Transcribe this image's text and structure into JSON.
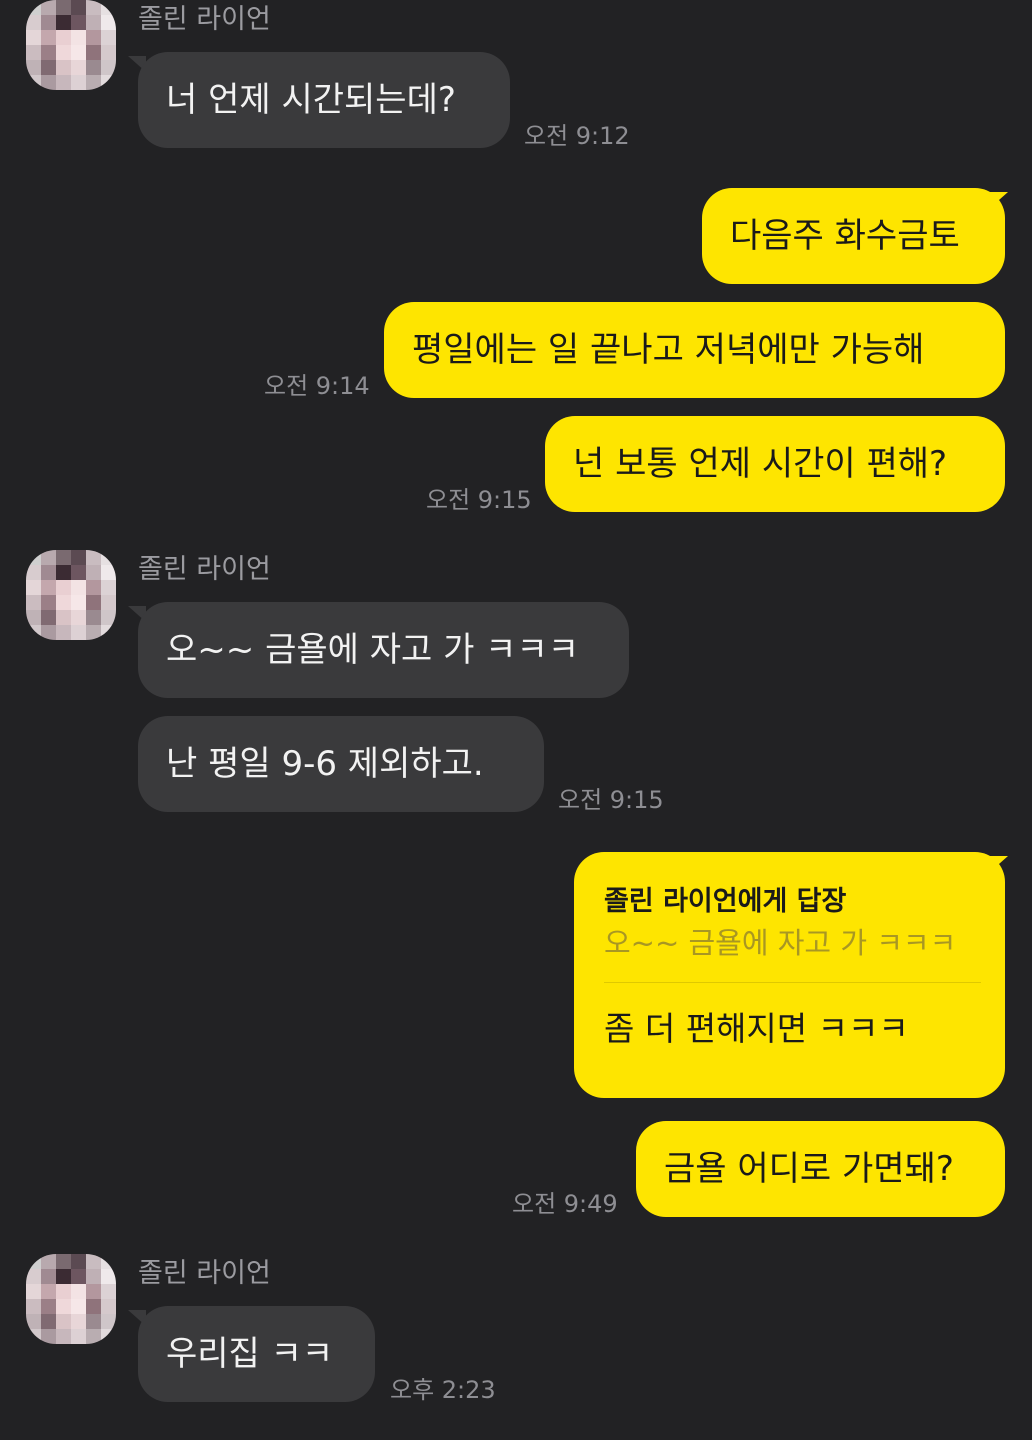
{
  "contact_name": "졸린 라이언",
  "messages": {
    "m1": {
      "text": "너 언제 시간되는데?",
      "time": "오전 9:12"
    },
    "m2": {
      "text": "다음주 화수금토"
    },
    "m3": {
      "text": "평일에는 일 끝나고 저녁에만 가능해",
      "time": "오전 9:14"
    },
    "m4": {
      "text": "넌 보통 언제 시간이 편해?",
      "time": "오전 9:15"
    },
    "m5": {
      "text": "오~~ 금욜에 자고 가 ㅋㅋㅋ"
    },
    "m6": {
      "text": "난 평일 9-6 제외하고.",
      "time": "오전 9:15"
    },
    "m7": {
      "reply_header": "졸린 라이언에게 답장",
      "quoted_text": "오~~ 금욜에 자고 가 ㅋㅋㅋ",
      "text": "좀 더 편해지면 ㅋㅋㅋ"
    },
    "m8": {
      "text": "금욜 어디로 가면돼?",
      "time": "오전 9:49"
    },
    "m9": {
      "text": "우리집 ㅋㅋ",
      "time": "오후 2:23"
    }
  },
  "colors": {
    "background": "#222224",
    "incoming_bubble": "#3a3a3c",
    "outgoing_bubble": "#fee500",
    "timestamp": "#8e8e93",
    "sender_name": "#9b9ba0"
  },
  "icons": {
    "avatar": "blurred-profile-avatar"
  }
}
